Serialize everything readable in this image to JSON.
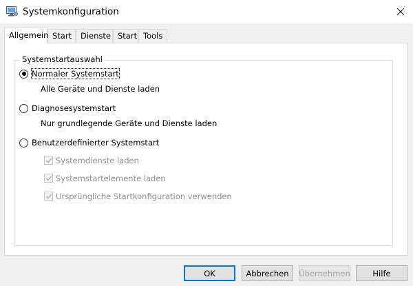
{
  "window": {
    "title": "Systemkonfiguration",
    "icon": "system-config-icon"
  },
  "tabs": [
    {
      "label": "Allgemein",
      "active": true
    },
    {
      "label": "Start",
      "active": false
    },
    {
      "label": "Dienste",
      "active": false
    },
    {
      "label": "Start",
      "active": false
    },
    {
      "label": "Tools",
      "active": false
    }
  ],
  "group": {
    "legend": "Systemstartauswahl"
  },
  "options": {
    "normal": {
      "label": "Normaler Systemstart",
      "description": "Alle Geräte und Dienste laden",
      "checked": true
    },
    "diagnostic": {
      "label": "Diagnosesystemstart",
      "description": "Nur grundlegende Geräte und Dienste laden",
      "checked": false
    },
    "custom": {
      "label": "Benutzerdefinierter Systemstart",
      "checked": false
    }
  },
  "custom_checks": [
    {
      "label": "Systemdienste laden",
      "checked": true,
      "enabled": false
    },
    {
      "label": "Systemstartelemente laden",
      "checked": true,
      "enabled": false
    },
    {
      "label": "Ursprüngliche Startkonfiguration verwenden",
      "checked": true,
      "enabled": false
    }
  ],
  "buttons": {
    "ok": "OK",
    "cancel": "Abbrechen",
    "apply": "Übernehmen",
    "help": "Hilfe"
  },
  "colors": {
    "accent": "#0078d7",
    "disabled_text": "#8c8c8c",
    "window_bg": "#f0f0f0"
  }
}
